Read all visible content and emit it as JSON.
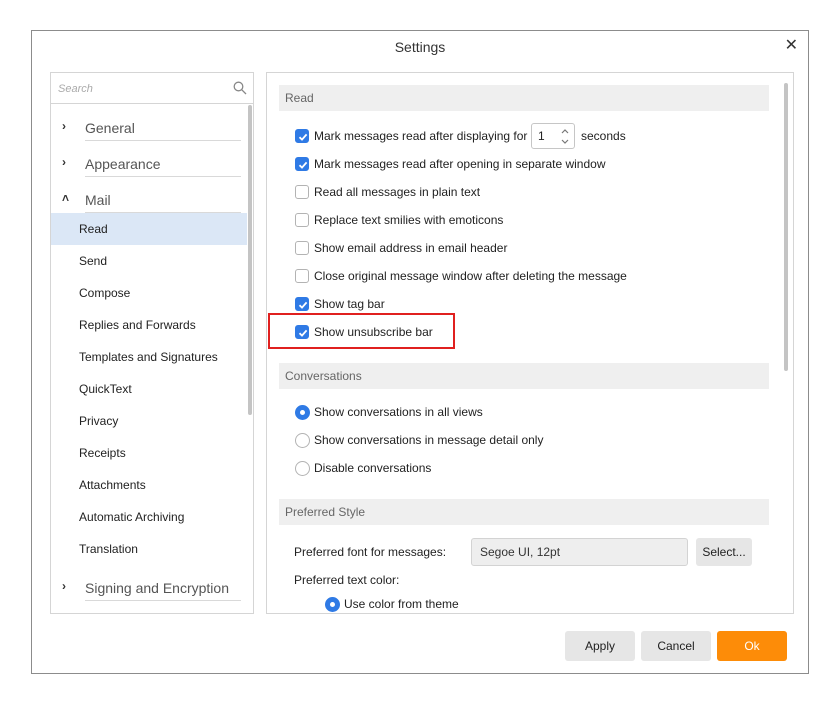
{
  "dialog": {
    "title": "Settings",
    "close_glyph": "✕"
  },
  "sidebar": {
    "search_placeholder": "Search",
    "categories": [
      {
        "label": "General",
        "chevron": "›",
        "expanded": false
      },
      {
        "label": "Appearance",
        "chevron": "›",
        "expanded": false
      },
      {
        "label": "Mail",
        "chevron": "˄",
        "expanded": true
      },
      {
        "label": "Signing and Encryption",
        "chevron": "›",
        "expanded": false
      }
    ],
    "mail_items": [
      {
        "label": "Read",
        "selected": true
      },
      {
        "label": "Send"
      },
      {
        "label": "Compose"
      },
      {
        "label": "Replies and Forwards"
      },
      {
        "label": "Templates and Signatures"
      },
      {
        "label": "QuickText"
      },
      {
        "label": "Privacy"
      },
      {
        "label": "Receipts"
      },
      {
        "label": "Attachments"
      },
      {
        "label": "Automatic Archiving"
      },
      {
        "label": "Translation"
      }
    ]
  },
  "read_section": {
    "header": "Read",
    "options": [
      {
        "label": "Mark messages read after displaying for",
        "checked": true,
        "suffix": "seconds",
        "spin_value": "1"
      },
      {
        "label": "Mark messages read after opening in separate window",
        "checked": true
      },
      {
        "label": "Read all messages in plain text",
        "checked": false
      },
      {
        "label": "Replace text smilies with emoticons",
        "checked": false
      },
      {
        "label": "Show email address in email header",
        "checked": false
      },
      {
        "label": "Close original message window after deleting the message",
        "checked": false
      },
      {
        "label": "Show tag bar",
        "checked": true
      },
      {
        "label": "Show unsubscribe bar",
        "checked": true
      }
    ]
  },
  "conversations_section": {
    "header": "Conversations",
    "options": [
      {
        "label": "Show conversations in all views",
        "selected": true
      },
      {
        "label": "Show conversations in message detail only",
        "selected": false
      },
      {
        "label": "Disable conversations",
        "selected": false
      }
    ]
  },
  "preferred_style": {
    "header": "Preferred Style",
    "font_label": "Preferred font for messages:",
    "font_value": "Segoe UI, 12pt",
    "select_button": "Select...",
    "color_label": "Preferred text color:",
    "color_option": "Use color from theme",
    "color_option_selected": true
  },
  "footer": {
    "apply": "Apply",
    "cancel": "Cancel",
    "ok": "Ok"
  },
  "colors": {
    "accent": "#2f7ae5",
    "ok_button": "#fd8c08",
    "highlight": "#e0201f",
    "selected_item": "#dbe7f6"
  }
}
